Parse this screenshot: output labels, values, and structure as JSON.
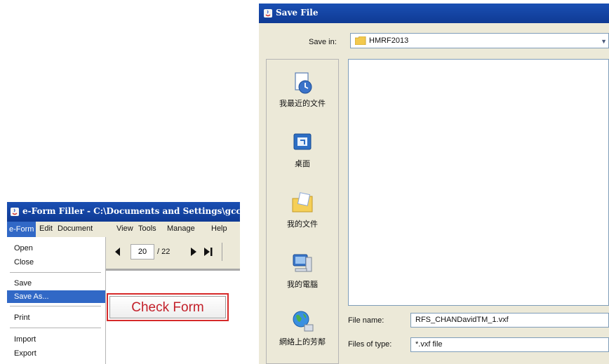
{
  "eform": {
    "title": "e-Form Filler - C:\\Documents and Settings\\gccleun",
    "menu": [
      "e-Form",
      "Edit",
      "Document",
      "View",
      "Tools",
      "Manage",
      "Help"
    ],
    "dropdown": [
      "Open",
      "Close",
      "Save",
      "Save As...",
      "Print",
      "Import",
      "Export"
    ],
    "highlighted_item": "Save As...",
    "toolbar": {
      "prev_icon": "triangle-left-icon",
      "page_current": "20",
      "page_total": "/ 22",
      "next_icon": "triangle-right-icon",
      "last_icon": "skip-to-end-icon"
    },
    "check_form_label": "Check Form"
  },
  "save_dialog": {
    "title": "Save File",
    "save_in_label": "Save in:",
    "save_in_value": "HMRF2013",
    "places": [
      "我最近的文件",
      "桌面",
      "我的文件",
      "我的電腦",
      "網絡上的芳鄰"
    ],
    "file_name_label": "File name:",
    "file_name_value": "RFS_CHANDavidTM_1.vxf",
    "files_of_type_label": "Files of type:",
    "files_of_type_value": "*.vxf file"
  },
  "colors": {
    "titlebar": "#1a4fb3",
    "menu_highlight": "#3168c6",
    "check_form_border": "#d62a2a",
    "check_form_text": "#c3202a",
    "dialog_bg": "#ece9d8"
  }
}
